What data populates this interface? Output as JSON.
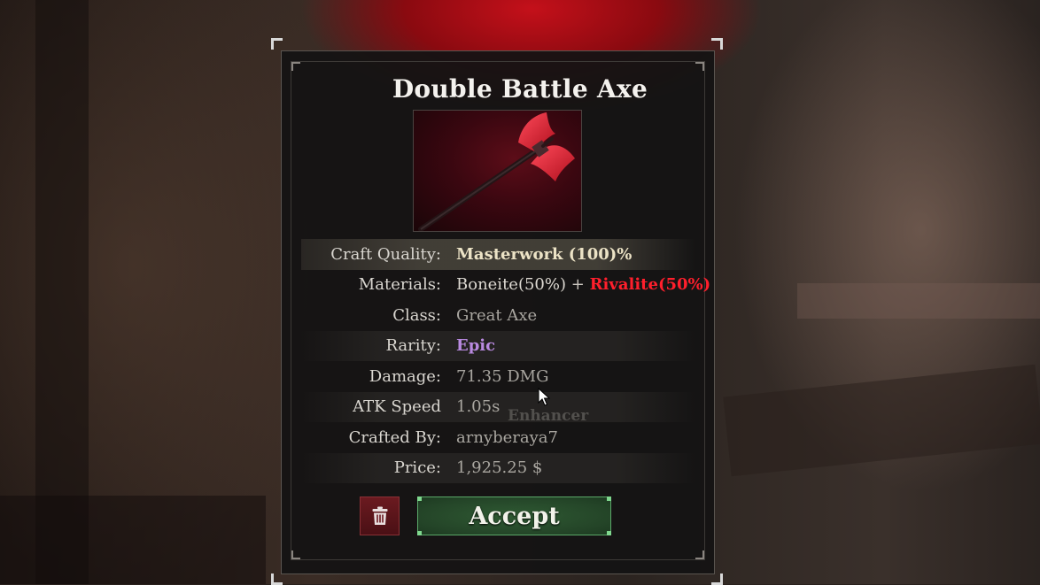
{
  "item": {
    "title": "Double Battle Axe",
    "image_icon": "double-battle-axe-icon"
  },
  "stats": [
    {
      "label": "Craft Quality:",
      "value": "Masterwork (100)%"
    },
    {
      "label": "Materials:",
      "value_primary": "Boneite(50%)",
      "separator": "+",
      "value_secondary": "Rivalite(50%)"
    },
    {
      "label": "Class:",
      "value": "Great Axe"
    },
    {
      "label": "Rarity:",
      "value": "Epic"
    },
    {
      "label": "Damage:",
      "value": "71.35 DMG"
    },
    {
      "label": "ATK Speed",
      "value": "1.05s"
    },
    {
      "label": "Crafted By:",
      "value": "arnyberaya7"
    },
    {
      "label": "Price:",
      "value": "1,925.25 $"
    }
  ],
  "background_text": "Enhancer",
  "buttons": {
    "delete_icon": "trash-icon",
    "accept_label": "Accept"
  },
  "colors": {
    "rarity_epic": "#b98ae0",
    "rivalite": "#ff1f2c",
    "accept_border": "#5aa868",
    "delete_bg": "#6b1a20"
  }
}
